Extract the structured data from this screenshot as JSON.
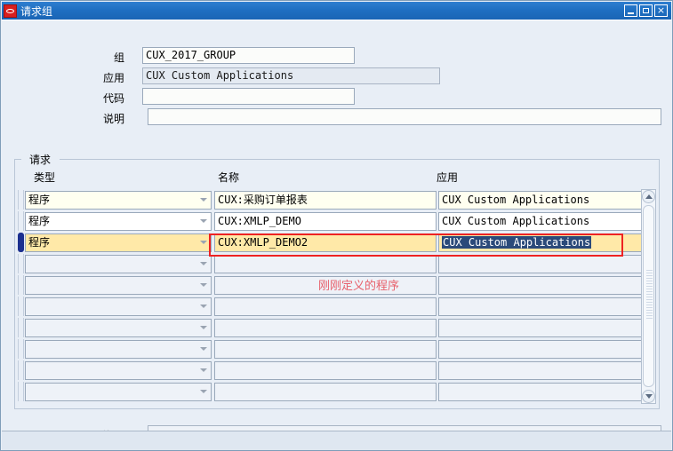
{
  "window": {
    "title": "请求组",
    "icon": "oracle-logo-icon",
    "controls": {
      "minimize": "minimize-button",
      "maximize": "maximize-button",
      "close": "×"
    },
    "accent_color": "#1f6fc2",
    "background_color": "#e8eef6"
  },
  "header_form": {
    "fields": [
      {
        "label": "组",
        "value": "CUX_2017_GROUP",
        "placeholder": "",
        "readonly": false
      },
      {
        "label": "应用",
        "value": "CUX Custom Applications",
        "placeholder": "",
        "readonly": true
      },
      {
        "label": "代码",
        "value": "",
        "placeholder": "",
        "readonly": false
      },
      {
        "label": "说明",
        "value": "",
        "placeholder": "",
        "readonly": false
      }
    ]
  },
  "request_block": {
    "legend": "请求",
    "columns": [
      "类型",
      "名称",
      "应用"
    ],
    "rows": [
      {
        "type": "程序",
        "name": "CUX:采购订单报表",
        "app": "CUX Custom Applications",
        "state": "filled-alt",
        "current": false
      },
      {
        "type": "程序",
        "name": "CUX:XMLP_DEMO",
        "app": "CUX Custom Applications",
        "state": "filled",
        "current": false
      },
      {
        "type": "程序",
        "name": "CUX:XMLP_DEMO2",
        "app": "CUX Custom Applications",
        "state": "current",
        "current": true
      },
      {
        "type": "",
        "name": "",
        "app": "",
        "state": "empty",
        "current": false
      },
      {
        "type": "",
        "name": "",
        "app": "",
        "state": "empty",
        "current": false
      },
      {
        "type": "",
        "name": "",
        "app": "",
        "state": "empty",
        "current": false
      },
      {
        "type": "",
        "name": "",
        "app": "",
        "state": "empty",
        "current": false
      },
      {
        "type": "",
        "name": "",
        "app": "",
        "state": "empty",
        "current": false
      },
      {
        "type": "",
        "name": "",
        "app": "",
        "state": "empty",
        "current": false
      },
      {
        "type": "",
        "name": "",
        "app": "",
        "state": "empty",
        "current": false
      }
    ],
    "selected_text": "CUX Custom Applications",
    "scrollbar": {
      "up": "scroll-up",
      "down": "scroll-down"
    }
  },
  "annotation": {
    "text": "刚刚定义的程序",
    "color": "#e8616c",
    "box_color": "#ee2222"
  },
  "footer": {
    "label": "说明",
    "value": "",
    "placeholder": ""
  }
}
